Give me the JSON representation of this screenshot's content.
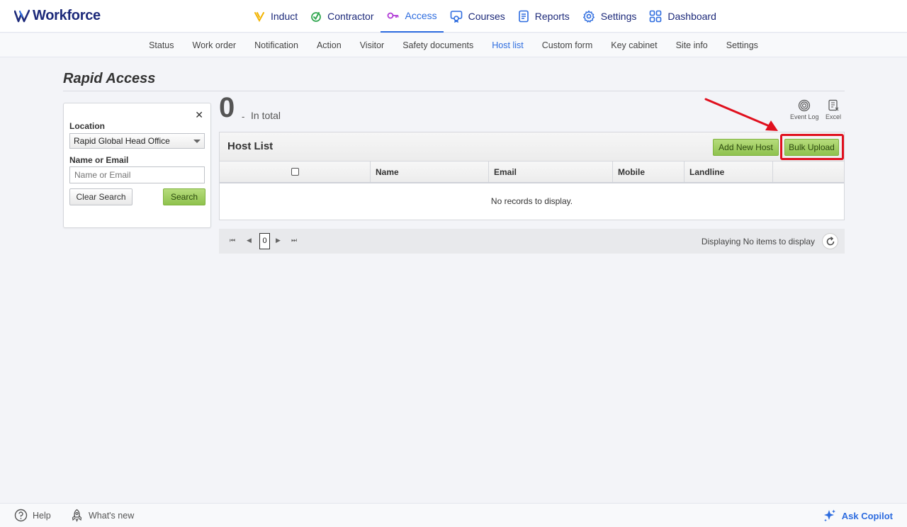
{
  "app": {
    "name": "Workforce"
  },
  "nav": [
    {
      "label": "Induct",
      "icon": "induct-v-icon",
      "color": "#f2b300"
    },
    {
      "label": "Contractor",
      "icon": "contractor-check-icon",
      "color": "#35a853"
    },
    {
      "label": "Access",
      "icon": "access-key-icon",
      "color": "#b03ad6",
      "active": true
    },
    {
      "label": "Courses",
      "icon": "courses-icon",
      "color": "#2d6cdf"
    },
    {
      "label": "Reports",
      "icon": "reports-icon",
      "color": "#2d6cdf"
    },
    {
      "label": "Settings",
      "icon": "gear-icon",
      "color": "#2d6cdf"
    },
    {
      "label": "Dashboard",
      "icon": "dashboard-grid-icon",
      "color": "#2d6cdf"
    }
  ],
  "subnav": [
    "Status",
    "Work order",
    "Notification",
    "Action",
    "Visitor",
    "Safety documents",
    "Host list",
    "Custom form",
    "Key cabinet",
    "Site info",
    "Settings"
  ],
  "subnav_active": "Host list",
  "page": {
    "title": "Rapid Access"
  },
  "search": {
    "location_label": "Location",
    "location_value": "Rapid Global Head Office",
    "name_label": "Name or Email",
    "name_placeholder": "Name or Email",
    "clear_label": "Clear Search",
    "search_label": "Search"
  },
  "summary": {
    "count": "0",
    "dash": "-",
    "label": "In total"
  },
  "tools": {
    "event_log": "Event Log",
    "excel": "Excel"
  },
  "grid": {
    "title": "Host List",
    "add_label": "Add New Host",
    "bulk_label": "Bulk Upload",
    "columns": [
      "Name",
      "Email",
      "Mobile",
      "Landline"
    ],
    "empty": "No records to display."
  },
  "pager": {
    "page": "0",
    "info": "Displaying No items to display"
  },
  "footer": {
    "help": "Help",
    "whats_new": "What's new",
    "copilot": "Ask Copilot"
  },
  "colors": {
    "accent": "#2d6cdf",
    "brand": "#1d2a7a",
    "highlight": "#e0101e",
    "green": "#8fc24e"
  }
}
